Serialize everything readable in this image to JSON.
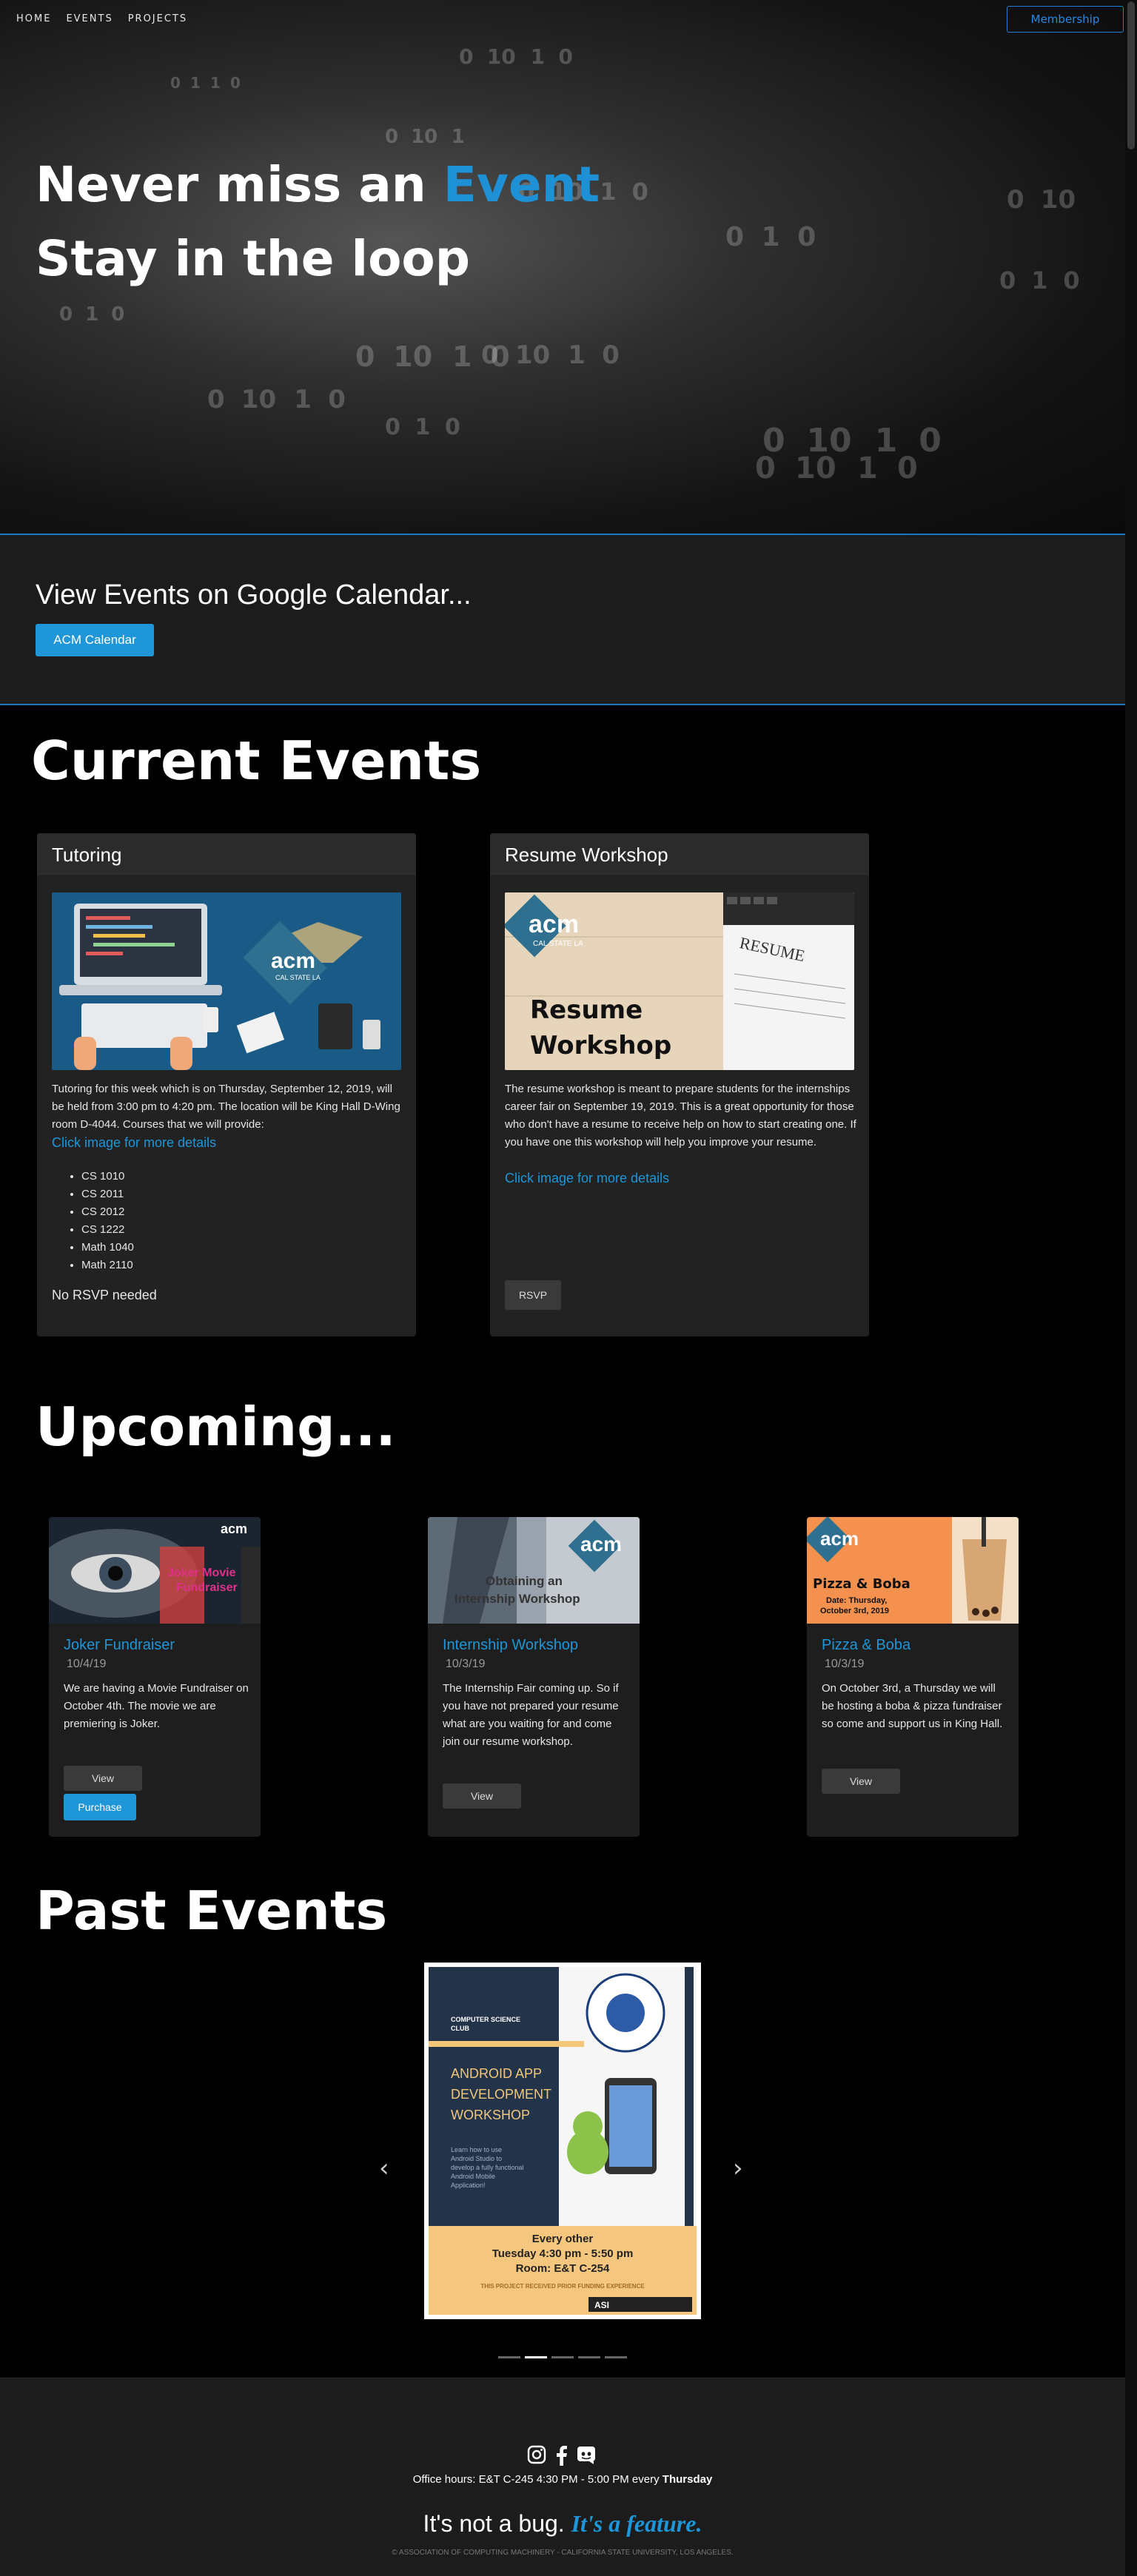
{
  "nav": {
    "items": [
      "HOME",
      "EVENTS",
      "PROJECTS"
    ],
    "membership": "Membership"
  },
  "hero": {
    "line1_part1": "Never miss an",
    "line1_accent": "Event",
    "line2": "Stay in the loop"
  },
  "calendar": {
    "title": "View Events on Google Calendar...",
    "button": "ACM Calendar"
  },
  "current": {
    "title": "Current Events",
    "tutoring": {
      "header": "Tutoring",
      "description": "Tutoring for this week which is on Thursday, September 12, 2019, will be held from 3:00 pm to 4:20 pm. The location will be King Hall D-Wing room D-4044. Courses that we will provide:",
      "link": "Click image for more details",
      "courses": [
        "CS 1010",
        "CS 2011",
        "CS 2012",
        "CS 1222",
        "Math 1040",
        "Math 2110"
      ],
      "note": "No RSVP needed",
      "img_text": {
        "logo": "acm",
        "sub": "CAL STATE LA"
      }
    },
    "resume": {
      "header": "Resume Workshop",
      "description": "The resume workshop is meant to prepare students for the internships career fair on September 19, 2019. This is a great opportunity for those who don't have a resume to receive help on how to start creating one. If you have one this workshop will help you improve your resume.",
      "link": "Click image for more details",
      "button": "RSVP",
      "img_text": {
        "logo": "acm",
        "sub": "CAL STATE LA",
        "title": "Resume Workshop",
        "paper": "RESUME"
      }
    }
  },
  "upcoming": {
    "title": "Upcoming...",
    "cards": [
      {
        "title": "Joker Fundraiser",
        "date": "10/4/19",
        "desc": "We are having a Movie Fundraiser on October 4th. The movie we are premiering is Joker.",
        "view": "View",
        "purchase": "Purchase",
        "img_text": "Joker Movie Fundraiser",
        "logo": "acm"
      },
      {
        "title": "Internship Workshop",
        "date": "10/3/19",
        "desc": "The Internship Fair coming up. So if you have not prepared your resume what are you waiting for and come join our resume workshop.",
        "view": "View",
        "img_text": "Obtaining an Internship Workshop",
        "logo": "acm"
      },
      {
        "title": "Pizza & Boba",
        "date": "10/3/19",
        "desc": "On October 3rd, a Thursday we will be hosting a boba & pizza fundraiser so come and support us in King Hall.",
        "view": "View",
        "img_text": "Pizza & Boba",
        "img_date": "Date: Thursday, October 3rd, 2019",
        "logo": "acm"
      }
    ]
  },
  "past": {
    "title": "Past Events",
    "poster": {
      "club": "COMPUTER SCIENCE CLUB",
      "title": "ANDROID APP DEVELOPMENT WORKSHOP",
      "blurb": "Learn how to use Android Studio to develop a fully functional Android Mobile Application!",
      "line1": "Every other",
      "line2": "Tuesday 4:30 pm - 5:50 pm",
      "line3": "Room: E&T C-254",
      "funded": "THIS PROJECT RECEIVED PRIOR FUNDING EXPERIENCE",
      "seal": "Association for Computing Machinery",
      "asi": "ASI"
    },
    "prev_arrow": "‹",
    "next_arrow": "›",
    "indicators": 5,
    "active_indicator": 1
  },
  "footer": {
    "icons": [
      "instagram-icon",
      "facebook-icon",
      "discord-icon"
    ],
    "hours_prefix": "Office hours: E&T C-245 4:30 PM - 5:00 PM every ",
    "hours_day": "Thursday",
    "slogan_plain": "It's not a bug.",
    "slogan_feature": "It's a feature.",
    "copyright": "© ASSOCIATION OF COMPUTING MACHINERY - CALIFORNIA STATE UNIVERSITY, LOS ANGELES."
  },
  "colors": {
    "accent": "#1e96d8",
    "background": "#000000",
    "card": "#222222"
  }
}
